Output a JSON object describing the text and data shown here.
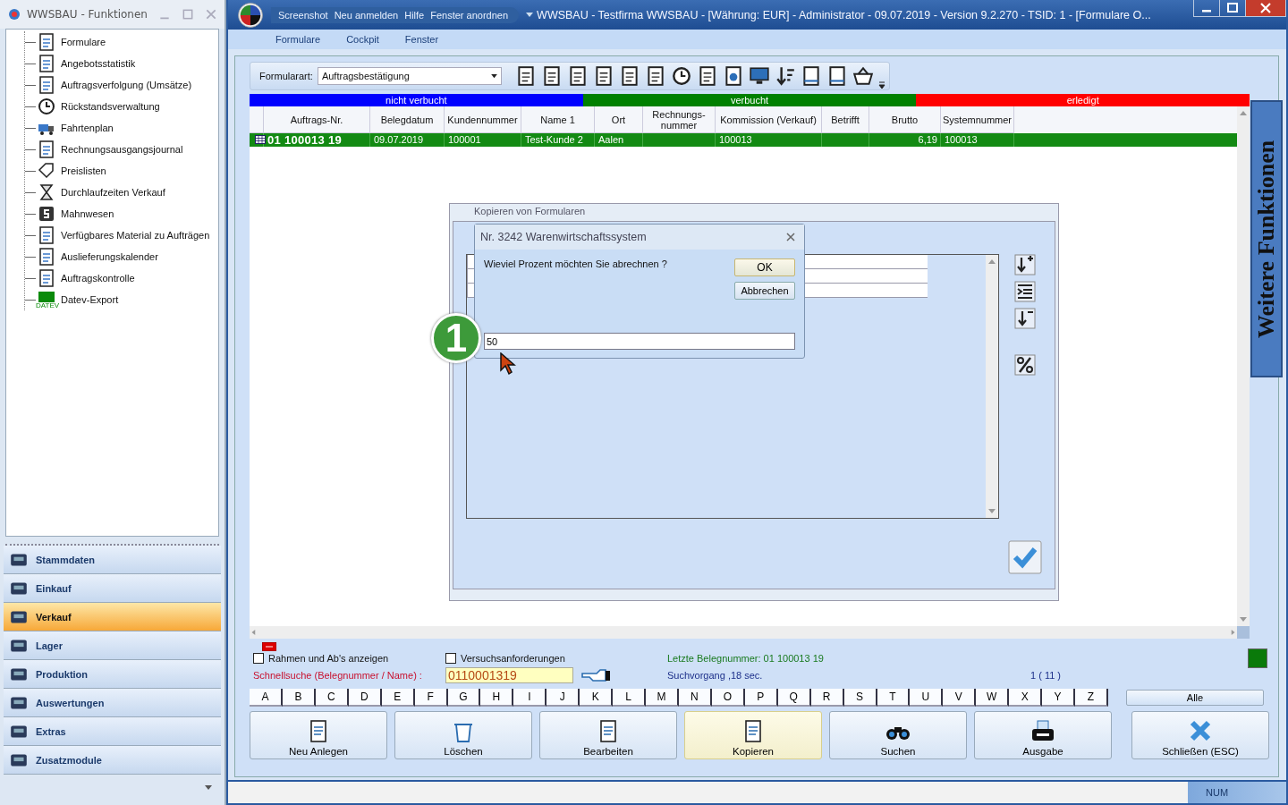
{
  "sidebar": {
    "title": "WWSBAU - Funktionen",
    "tree": [
      {
        "label": "Formulare"
      },
      {
        "label": "Angebotsstatistik"
      },
      {
        "label": "Auftragsverfolgung (Umsätze)"
      },
      {
        "label": "Rückstandsverwaltung"
      },
      {
        "label": "Fahrtenplan"
      },
      {
        "label": "Rechnungsausgangsjournal"
      },
      {
        "label": "Preislisten"
      },
      {
        "label": "Durchlaufzeiten Verkauf"
      },
      {
        "label": "Mahnwesen"
      },
      {
        "label": "Verfügbares Material zu Aufträgen"
      },
      {
        "label": "Auslieferungskalender"
      },
      {
        "label": "Auftragskontrolle"
      },
      {
        "label": "Datev-Export",
        "icon_text": "DATEV"
      }
    ],
    "nav": [
      {
        "label": "Stammdaten",
        "selected": false
      },
      {
        "label": "Einkauf",
        "selected": false
      },
      {
        "label": "Verkauf",
        "selected": true
      },
      {
        "label": "Lager",
        "selected": false
      },
      {
        "label": "Produktion",
        "selected": false
      },
      {
        "label": "Auswertungen",
        "selected": false
      },
      {
        "label": "Extras",
        "selected": false
      },
      {
        "label": "Zusatzmodule",
        "selected": false
      }
    ]
  },
  "window": {
    "title": "WWSBAU - Testfirma WWSBAU - [Währung: EUR] - Administrator - 09.07.2019 - Version 9.2.270 - TSID: 1  - [Formulare O...",
    "quick_access": [
      "Screenshot",
      "Neu anmelden",
      "Hilfe",
      "Fenster anordnen"
    ],
    "ribbon_tabs": [
      "Formulare",
      "Cockpit",
      "Fenster"
    ]
  },
  "toolbar": {
    "label": "Formularart:",
    "value": "Auftragsbestätigung"
  },
  "status_band": [
    {
      "label": "nicht verbucht",
      "color": "#0000ff"
    },
    {
      "label": "verbucht",
      "color": "#008000"
    },
    {
      "label": "erledigt",
      "color": "#ff0000"
    }
  ],
  "table": {
    "columns": [
      "Auftrags-Nr.",
      "Belegdatum",
      "Kundennummer",
      "Name 1",
      "Ort",
      "Rechnungs-\nnummer",
      "Kommission (Verkauf)",
      "Betrifft",
      "Brutto",
      "Systemnummer"
    ],
    "rows": [
      {
        "selected": true,
        "cells": [
          "01 100013 19",
          "09.07.2019",
          "100001",
          "Test-Kunde 2",
          "Aalen",
          "",
          "100013",
          "",
          "6,19",
          "100013"
        ]
      }
    ]
  },
  "copy_dialog": {
    "title": "Kopieren von Formularen"
  },
  "prompt": {
    "title": "Nr. 3242 Warenwirtschaftssystem",
    "message": "Wieviel Prozent möchten Sie abrechnen ?",
    "buttons": [
      "OK",
      "Abbrechen"
    ],
    "value": "50"
  },
  "annotation": "1",
  "side_tab": "Weitere Funktionen",
  "filters": {
    "checkboxes": [
      {
        "label": "Rahmen und Ab's anzeigen",
        "checked": false
      },
      {
        "label": "Versuchsanforderungen",
        "checked": false
      }
    ],
    "search_label": "Schnellsuche (Belegnummer / Name) :",
    "search_value": "0110001319",
    "last_number": "Letzte Belegnummer: 01 100013 19",
    "search_time": "Suchvorgang ,18 sec.",
    "count": "1 ( 11 )"
  },
  "letters": [
    "A",
    "B",
    "C",
    "D",
    "E",
    "F",
    "G",
    "H",
    "I",
    "J",
    "K",
    "L",
    "M",
    "N",
    "O",
    "P",
    "Q",
    "R",
    "S",
    "T",
    "U",
    "V",
    "W",
    "X",
    "Y",
    "Z"
  ],
  "all_button": "Alle",
  "actions": [
    {
      "label": "Neu Anlegen",
      "selected": false
    },
    {
      "label": "Löschen",
      "selected": false
    },
    {
      "label": "Bearbeiten",
      "selected": false
    },
    {
      "label": "Kopieren",
      "selected": true
    },
    {
      "label": "Suchen",
      "selected": false
    },
    {
      "label": "Ausgabe",
      "selected": false
    },
    {
      "label": "Schließen (ESC)",
      "selected": false
    }
  ],
  "status_bar": {
    "num": "NUM"
  }
}
